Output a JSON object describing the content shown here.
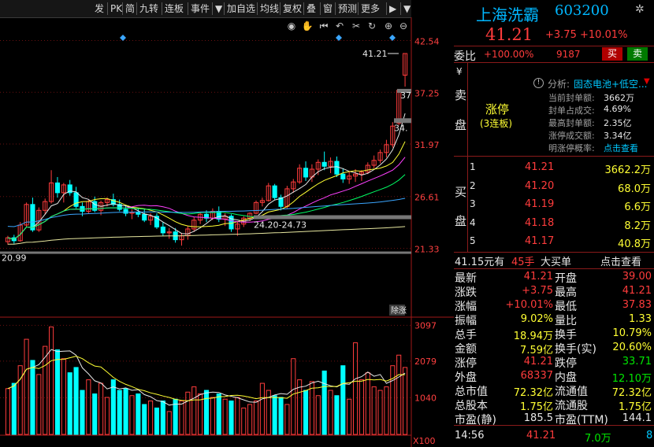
{
  "toolbar": {
    "items": [
      "发",
      "PK",
      "简",
      "九转",
      "连板",
      "事件",
      "▼",
      "加自选",
      "均线",
      "复权",
      "叠",
      "窗",
      "预测",
      "更多",
      "▶",
      "▼"
    ]
  },
  "stock": {
    "name": "上海洗霸",
    "code": "603200",
    "price": "41.21",
    "change": "+3.75",
    "pct": "+10.01%"
  },
  "weibi": {
    "label": "委比",
    "pct": "+100.00%",
    "diff": "9187",
    "buy_btn": "买",
    "sell_btn": "卖"
  },
  "sell_panel": {
    "yen": "¥",
    "side_label": [
      "卖",
      "盘"
    ],
    "limit_up": "涨停",
    "limit_sub": "(3连板)",
    "analysis_label": "分析:",
    "analysis_value": "固态电池+低空...",
    "rows": [
      {
        "k": "当前封单额:",
        "v": "3662万"
      },
      {
        "k": "封单占成交:",
        "v": "4.69%"
      },
      {
        "k": "最高封单额:",
        "v": "2.35亿"
      },
      {
        "k": "涨停成交额:",
        "v": "3.34亿"
      },
      {
        "k": "明涨停概率:",
        "v": "点击查看"
      }
    ]
  },
  "buy_panel": {
    "side_label": [
      "买",
      "盘"
    ],
    "rows": [
      {
        "n": "1",
        "p": "41.21",
        "v": "3662.2万"
      },
      {
        "n": "2",
        "p": "41.20",
        "v": "68.0万"
      },
      {
        "n": "3",
        "p": "41.19",
        "v": "6.6万"
      },
      {
        "n": "4",
        "p": "41.18",
        "v": "8.2万"
      },
      {
        "n": "5",
        "p": "41.17",
        "v": "40.8万"
      }
    ]
  },
  "big_order": {
    "price": "41.15元有",
    "lots": "45手",
    "type": "大买单",
    "link": "点击查看"
  },
  "quote": [
    {
      "l1": "最新",
      "v1": "41.21",
      "c1": "red",
      "l2": "开盘",
      "v2": "39.00",
      "c2": "red"
    },
    {
      "l1": "涨跌",
      "v1": "+3.75",
      "c1": "red",
      "l2": "最高",
      "v2": "41.21",
      "c2": "red"
    },
    {
      "l1": "涨幅",
      "v1": "+10.01%",
      "c1": "red",
      "l2": "最低",
      "v2": "37.83",
      "c2": "red"
    },
    {
      "l1": "振幅",
      "v1": "9.02%",
      "c1": "yellow",
      "l2": "量比",
      "v2": "1.33",
      "c2": "yellow"
    },
    {
      "l1": "总手",
      "v1": "18.94万",
      "c1": "yellow",
      "l2": "换手",
      "v2": "10.79%",
      "c2": "yellow"
    },
    {
      "l1": "金额",
      "v1": "7.59亿",
      "c1": "yellow",
      "l2": "换手(实)",
      "v2": "20.60%",
      "c2": "yellow"
    },
    {
      "l1": "涨停",
      "v1": "41.21",
      "c1": "red",
      "l2": "跌停",
      "v2": "33.71",
      "c2": "green"
    },
    {
      "l1": "外盘",
      "v1": "68337",
      "c1": "red",
      "l2": "内盘",
      "v2": "12.10万",
      "c2": "green"
    },
    {
      "l1": "总市值",
      "v1": "72.32亿",
      "c1": "yellow",
      "l2": "流通值",
      "v2": "72.32亿",
      "c2": "yellow"
    },
    {
      "l1": "总股本",
      "v1": "1.75亿",
      "c1": "yellow",
      "l2": "流通股",
      "v2": "1.75亿",
      "c2": "yellow"
    },
    {
      "l1": "市盈(静)",
      "v1": "185.5",
      "c1": "white",
      "l2": "市盈(TTM)",
      "v2": "144.1",
      "c2": "white"
    }
  ],
  "tick": {
    "time": "14:56",
    "price": "41.21",
    "vol": "7.0万",
    "n": "8"
  },
  "chart_data": {
    "type": "candlestick",
    "price_axis": {
      "ticks": [
        "42.54",
        "37.25",
        "31.97",
        "26.61",
        "21.33"
      ],
      "range": [
        21.33,
        42.54
      ]
    },
    "volume_axis": {
      "ticks": [
        "3097",
        "2079",
        "1040",
        "X100"
      ]
    },
    "annotations": {
      "high_label": "41.21",
      "low_label": "24.20-24.73",
      "left_label": "20.99",
      "right_tag_37": "37",
      "right_tag_34": "34.",
      "corner_tag": "除涨"
    },
    "candles": [
      [
        22.0,
        22.6,
        21.7,
        22.4
      ],
      [
        22.4,
        22.7,
        21.8,
        22.1
      ],
      [
        22.1,
        24.0,
        22.0,
        23.7
      ],
      [
        23.7,
        26.0,
        23.5,
        25.8
      ],
      [
        25.8,
        26.5,
        23.0,
        23.2
      ],
      [
        23.2,
        25.5,
        23.0,
        25.2
      ],
      [
        25.2,
        26.4,
        24.8,
        26.1
      ],
      [
        26.1,
        29.3,
        25.9,
        28.0
      ],
      [
        28.0,
        28.6,
        26.5,
        27.0
      ],
      [
        27.0,
        28.0,
        26.0,
        27.8
      ],
      [
        27.8,
        28.3,
        26.7,
        27.0
      ],
      [
        27.0,
        27.6,
        25.4,
        25.6
      ],
      [
        25.6,
        26.0,
        24.6,
        25.1
      ],
      [
        25.1,
        26.3,
        24.9,
        26.1
      ],
      [
        26.1,
        26.6,
        25.0,
        25.2
      ],
      [
        25.2,
        26.2,
        24.7,
        26.0
      ],
      [
        26.0,
        26.5,
        25.6,
        26.3
      ],
      [
        26.3,
        26.9,
        25.6,
        25.8
      ],
      [
        25.8,
        26.3,
        25.1,
        25.3
      ],
      [
        25.3,
        25.7,
        24.6,
        24.9
      ],
      [
        24.9,
        25.3,
        24.3,
        25.0
      ],
      [
        25.0,
        25.4,
        24.5,
        24.8
      ],
      [
        24.8,
        25.3,
        24.0,
        24.2
      ],
      [
        24.2,
        24.9,
        23.7,
        24.6
      ],
      [
        24.6,
        24.9,
        23.3,
        23.5
      ],
      [
        23.5,
        24.0,
        22.6,
        22.9
      ],
      [
        22.9,
        23.4,
        22.3,
        23.0
      ],
      [
        23.0,
        23.4,
        21.9,
        22.2
      ],
      [
        22.2,
        22.9,
        21.6,
        22.6
      ],
      [
        22.6,
        23.6,
        22.2,
        23.3
      ],
      [
        23.3,
        24.5,
        23.0,
        24.2
      ],
      [
        24.2,
        25.0,
        23.8,
        24.8
      ],
      [
        24.8,
        25.2,
        24.0,
        24.4
      ],
      [
        24.4,
        25.4,
        24.2,
        25.1
      ],
      [
        25.1,
        25.6,
        24.0,
        24.3
      ],
      [
        24.3,
        24.9,
        23.6,
        24.6
      ],
      [
        24.6,
        24.8,
        23.0,
        23.3
      ],
      [
        23.3,
        24.1,
        22.6,
        23.8
      ],
      [
        23.8,
        24.6,
        23.5,
        24.4
      ],
      [
        24.4,
        25.0,
        24.1,
        24.9
      ],
      [
        24.9,
        26.2,
        24.8,
        26.0
      ],
      [
        26.0,
        26.5,
        25.6,
        26.2
      ],
      [
        26.2,
        28.0,
        26.1,
        27.7
      ],
      [
        27.7,
        27.9,
        26.3,
        26.5
      ],
      [
        26.5,
        26.8,
        25.2,
        25.6
      ],
      [
        25.6,
        27.7,
        25.4,
        27.4
      ],
      [
        27.4,
        28.4,
        27.0,
        28.1
      ],
      [
        28.1,
        29.9,
        27.9,
        29.5
      ],
      [
        29.5,
        30.2,
        28.2,
        28.6
      ],
      [
        28.6,
        29.9,
        28.1,
        29.4
      ],
      [
        29.4,
        30.4,
        28.8,
        30.1
      ],
      [
        30.1,
        31.2,
        29.3,
        29.7
      ],
      [
        29.7,
        30.6,
        29.0,
        30.2
      ],
      [
        30.2,
        30.7,
        28.6,
        28.9
      ],
      [
        28.9,
        29.5,
        28.0,
        28.4
      ],
      [
        28.4,
        29.2,
        27.9,
        28.7
      ],
      [
        28.7,
        29.4,
        28.1,
        28.9
      ],
      [
        28.9,
        29.3,
        28.2,
        29.1
      ],
      [
        29.1,
        30.1,
        28.9,
        29.8
      ],
      [
        29.8,
        30.8,
        29.5,
        30.3
      ],
      [
        30.3,
        31.4,
        30.0,
        31.1
      ],
      [
        31.1,
        32.4,
        30.6,
        31.9
      ],
      [
        31.9,
        34.2,
        31.6,
        33.8
      ],
      [
        34.1,
        37.5,
        33.9,
        37.46
      ],
      [
        39.0,
        41.21,
        37.83,
        41.21
      ]
    ],
    "volumes": [
      1300,
      1450,
      1950,
      2700,
      2100,
      1700,
      2500,
      3050,
      2400,
      2150,
      1750,
      1900,
      1250,
      1550,
      1150,
      1450,
      1050,
      1550,
      1250,
      1300,
      1100,
      1150,
      850,
      950,
      750,
      950,
      650,
      1000,
      950,
      1200,
      1350,
      1150,
      1250,
      1050,
      1150,
      1000,
      950,
      1050,
      750,
      850,
      950,
      1450,
      1250,
      1100,
      1050,
      850,
      2150,
      1550,
      1250,
      1500,
      1100,
      1800,
      1250,
      1100,
      1950,
      1000,
      2600,
      1550,
      1750,
      1350,
      1250,
      1350,
      1950,
      2250,
      1900
    ],
    "ma_lines": [
      {
        "name": "MA5",
        "color": "#e8e8e8"
      },
      {
        "name": "MA10",
        "color": "#ffff33"
      },
      {
        "name": "MA20",
        "color": "#ff40ff"
      },
      {
        "name": "MA30",
        "color": "#00ff66"
      },
      {
        "name": "MA60",
        "color": "#3aa6ff"
      },
      {
        "name": "MA120",
        "color": "#e8e8a0"
      }
    ],
    "volume_ma": [
      {
        "name": "VMA5",
        "color": "#e8e8e8"
      },
      {
        "name": "VMA10",
        "color": "#ffff33"
      }
    ]
  }
}
